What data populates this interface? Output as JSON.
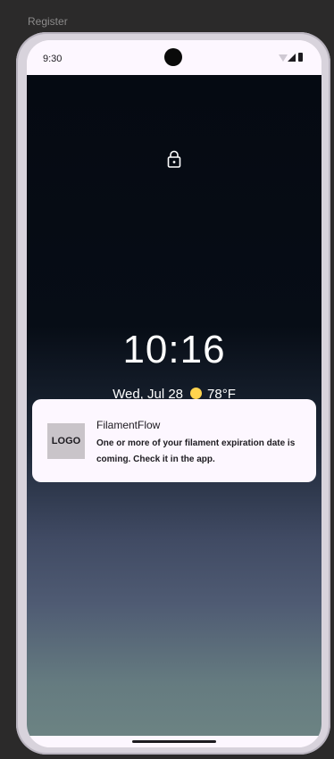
{
  "frame": {
    "label": "Register"
  },
  "status_bar": {
    "time": "9:30",
    "icons": [
      "wifi-icon",
      "signal-icon",
      "battery-icon"
    ]
  },
  "lockscreen": {
    "lock_icon": "lock-icon",
    "clock": "10:16",
    "date": "Wed, Jul 28",
    "weather_icon": "sun-icon",
    "temperature": "78°F"
  },
  "notification": {
    "logo_text": "LOGO",
    "title": "FilamentFlow",
    "body": "One or more of your filament expiration date is coming. Check it in the app."
  },
  "colors": {
    "background": "#2b2a2a",
    "screen": "#fdf7ff",
    "accent_weather": "#ffd34e"
  }
}
